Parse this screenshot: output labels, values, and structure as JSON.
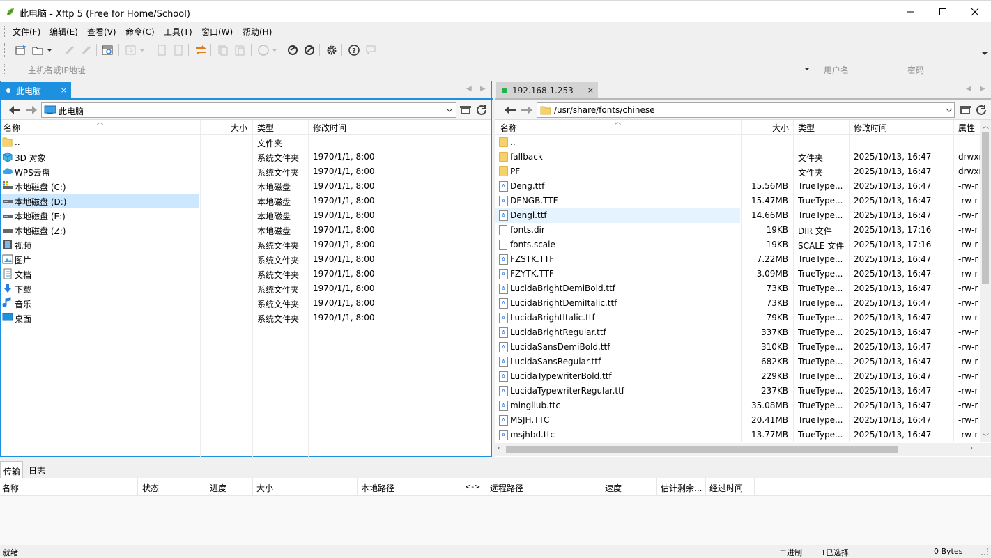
{
  "window": {
    "title": "此电脑 - Xftp 5 (Free for Home/School)"
  },
  "menu": [
    "文件(F)",
    "编辑(E)",
    "查看(V)",
    "命令(C)",
    "工具(T)",
    "窗口(W)",
    "帮助(H)"
  ],
  "address": {
    "host_placeholder": "主机名或IP地址",
    "user_placeholder": "用户名",
    "password_placeholder": "密码"
  },
  "left": {
    "tab": "此电脑",
    "path": "此电脑",
    "headers": {
      "name": "名称",
      "size": "大小",
      "type": "类型",
      "modified": "修改时间"
    },
    "rows": [
      {
        "name": "..",
        "type": "文件夹",
        "modified": "",
        "icon": "folder-up-icon"
      },
      {
        "name": "3D 对象",
        "type": "系统文件夹",
        "modified": "1970/1/1, 8:00",
        "icon": "3d-objects-icon"
      },
      {
        "name": "WPS云盘",
        "type": "系统文件夹",
        "modified": "1970/1/1, 8:00",
        "icon": "cloud-icon"
      },
      {
        "name": "本地磁盘 (C:)",
        "type": "本地磁盘",
        "modified": "1970/1/1, 8:00",
        "icon": "system-drive-icon"
      },
      {
        "name": "本地磁盘 (D:)",
        "type": "本地磁盘",
        "modified": "1970/1/1, 8:00",
        "icon": "drive-icon"
      },
      {
        "name": "本地磁盘 (E:)",
        "type": "本地磁盘",
        "modified": "1970/1/1, 8:00",
        "icon": "drive-icon"
      },
      {
        "name": "本地磁盘 (Z:)",
        "type": "本地磁盘",
        "modified": "1970/1/1, 8:00",
        "icon": "drive-icon"
      },
      {
        "name": "视频",
        "type": "系统文件夹",
        "modified": "1970/1/1, 8:00",
        "icon": "video-icon"
      },
      {
        "name": "图片",
        "type": "系统文件夹",
        "modified": "1970/1/1, 8:00",
        "icon": "pictures-icon"
      },
      {
        "name": "文档",
        "type": "系统文件夹",
        "modified": "1970/1/1, 8:00",
        "icon": "documents-icon"
      },
      {
        "name": "下载",
        "type": "系统文件夹",
        "modified": "1970/1/1, 8:00",
        "icon": "download-icon"
      },
      {
        "name": "音乐",
        "type": "系统文件夹",
        "modified": "1970/1/1, 8:00",
        "icon": "music-icon"
      },
      {
        "name": "桌面",
        "type": "系统文件夹",
        "modified": "1970/1/1, 8:00",
        "icon": "desktop-icon"
      }
    ],
    "selected_index": 4
  },
  "right": {
    "tab": "192.168.1.253",
    "path": "/usr/share/fonts/chinese",
    "headers": {
      "name": "名称",
      "size": "大小",
      "type": "类型",
      "modified": "修改时间",
      "attr": "属性"
    },
    "rows": [
      {
        "name": "..",
        "size": "",
        "type": "",
        "modified": "",
        "attr": "",
        "kind": "folder"
      },
      {
        "name": "fallback",
        "size": "",
        "type": "文件夹",
        "modified": "2025/10/13, 16:47",
        "attr": "drwxr",
        "kind": "folder"
      },
      {
        "name": "PF",
        "size": "",
        "type": "文件夹",
        "modified": "2025/10/13, 16:47",
        "attr": "drwxr",
        "kind": "folder"
      },
      {
        "name": "Deng.ttf",
        "size": "15.56MB",
        "type": "TrueType...",
        "modified": "2025/10/13, 16:47",
        "attr": "-rw-r",
        "kind": "font"
      },
      {
        "name": "DENGB.TTF",
        "size": "15.47MB",
        "type": "TrueType...",
        "modified": "2025/10/13, 16:47",
        "attr": "-rw-r",
        "kind": "font"
      },
      {
        "name": "Dengl.ttf",
        "size": "14.66MB",
        "type": "TrueType...",
        "modified": "2025/10/13, 16:47",
        "attr": "-rw-r",
        "kind": "font"
      },
      {
        "name": "fonts.dir",
        "size": "19KB",
        "type": "DIR 文件",
        "modified": "2025/10/13, 17:16",
        "attr": "-rw-r",
        "kind": "file"
      },
      {
        "name": "fonts.scale",
        "size": "19KB",
        "type": "SCALE 文件",
        "modified": "2025/10/13, 17:16",
        "attr": "-rw-r",
        "kind": "file"
      },
      {
        "name": "FZSTK.TTF",
        "size": "7.22MB",
        "type": "TrueType...",
        "modified": "2025/10/13, 16:47",
        "attr": "-rw-r",
        "kind": "font"
      },
      {
        "name": "FZYTK.TTF",
        "size": "3.09MB",
        "type": "TrueType...",
        "modified": "2025/10/13, 16:47",
        "attr": "-rw-r",
        "kind": "font"
      },
      {
        "name": "LucidaBrightDemiBold.ttf",
        "size": "73KB",
        "type": "TrueType...",
        "modified": "2025/10/13, 16:47",
        "attr": "-rw-r",
        "kind": "font"
      },
      {
        "name": "LucidaBrightDemiItalic.ttf",
        "size": "73KB",
        "type": "TrueType...",
        "modified": "2025/10/13, 16:47",
        "attr": "-rw-r",
        "kind": "font"
      },
      {
        "name": "LucidaBrightItalic.ttf",
        "size": "79KB",
        "type": "TrueType...",
        "modified": "2025/10/13, 16:47",
        "attr": "-rw-r",
        "kind": "font"
      },
      {
        "name": "LucidaBrightRegular.ttf",
        "size": "337KB",
        "type": "TrueType...",
        "modified": "2025/10/13, 16:47",
        "attr": "-rw-r",
        "kind": "font"
      },
      {
        "name": "LucidaSansDemiBold.ttf",
        "size": "310KB",
        "type": "TrueType...",
        "modified": "2025/10/13, 16:47",
        "attr": "-rw-r",
        "kind": "font"
      },
      {
        "name": "LucidaSansRegular.ttf",
        "size": "682KB",
        "type": "TrueType...",
        "modified": "2025/10/13, 16:47",
        "attr": "-rw-r",
        "kind": "font"
      },
      {
        "name": "LucidaTypewriterBold.ttf",
        "size": "229KB",
        "type": "TrueType...",
        "modified": "2025/10/13, 16:47",
        "attr": "-rw-r",
        "kind": "font"
      },
      {
        "name": "LucidaTypewriterRegular.ttf",
        "size": "237KB",
        "type": "TrueType...",
        "modified": "2025/10/13, 16:47",
        "attr": "-rw-r",
        "kind": "font"
      },
      {
        "name": "mingliub.ttc",
        "size": "35.08MB",
        "type": "TrueType...",
        "modified": "2025/10/13, 16:47",
        "attr": "-rw-r",
        "kind": "font"
      },
      {
        "name": "MSJH.TTC",
        "size": "20.41MB",
        "type": "TrueType...",
        "modified": "2025/10/13, 16:47",
        "attr": "-rw-r",
        "kind": "font"
      },
      {
        "name": "msjhbd.ttc",
        "size": "13.77MB",
        "type": "TrueType...",
        "modified": "2025/10/13, 16:47",
        "attr": "-rw-r",
        "kind": "font"
      }
    ],
    "selected_index": 5
  },
  "bottom": {
    "tabs": [
      "传输",
      "日志"
    ],
    "headers": [
      "名称",
      "状态",
      "进度",
      "大小",
      "本地路径",
      "<->",
      "远程路径",
      "速度",
      "估计剩余...",
      "经过时间"
    ]
  },
  "status": {
    "left": "就绪",
    "mode": "二进制",
    "selection": "1已选择",
    "bytes": "0 Bytes"
  },
  "colors": {
    "accent": "#1e90e0",
    "selection": "#cce8ff",
    "connected": "#22b14c"
  }
}
